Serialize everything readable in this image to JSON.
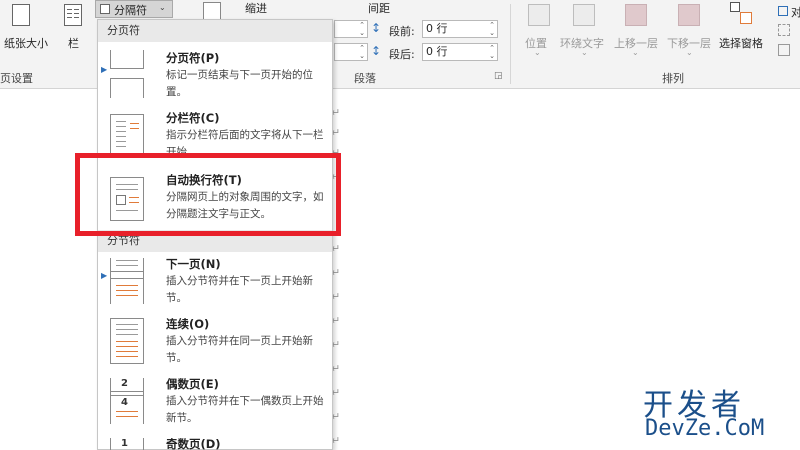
{
  "ribbon": {
    "page_setup": {
      "size_label": "纸张大小",
      "columns_label": "栏",
      "group_label": "页设置"
    },
    "breaks_button": {
      "label": "分隔符"
    },
    "paragraph": {
      "indent_label": "缩进",
      "spacing_label": "间距",
      "before_label": "段前:",
      "after_label": "段后:",
      "before_value": "0 行",
      "after_value": "0 行",
      "group_label": "段落"
    },
    "arrange": {
      "position_label": "位置",
      "wrap_label": "环绕文字",
      "forward_label": "上移一层",
      "backward_label": "下移一层",
      "pane_label": "选择窗格",
      "align_label": "对",
      "group_label": "排列"
    }
  },
  "menu": {
    "section1": "分页符",
    "section2": "分节符",
    "items": [
      {
        "title": "分页符(P)",
        "desc": "标记一页结束与下一页开始的位置。"
      },
      {
        "title": "分栏符(C)",
        "desc": "指示分栏符后面的文字将从下一栏开始。"
      },
      {
        "title": "自动换行符(T)",
        "desc": "分隔网页上的对象周围的文字，如分隔题注文字与正文。"
      },
      {
        "title": "下一页(N)",
        "desc": "插入分节符并在下一页上开始新节。"
      },
      {
        "title": "连续(O)",
        "desc": "插入分节符并在同一页上开始新节。"
      },
      {
        "title": "偶数页(E)",
        "desc": "插入分节符并在下一偶数页上开始新节。"
      },
      {
        "title": "奇数页(D)",
        "desc": ""
      }
    ],
    "even_icon_num": "2",
    "even_icon_num2": "4",
    "odd_icon_num": "1"
  },
  "highlight_color": "#e8202a",
  "return_mark": "↵",
  "watermark": {
    "line1": "开发者",
    "line2": "DevZe.CoM"
  }
}
